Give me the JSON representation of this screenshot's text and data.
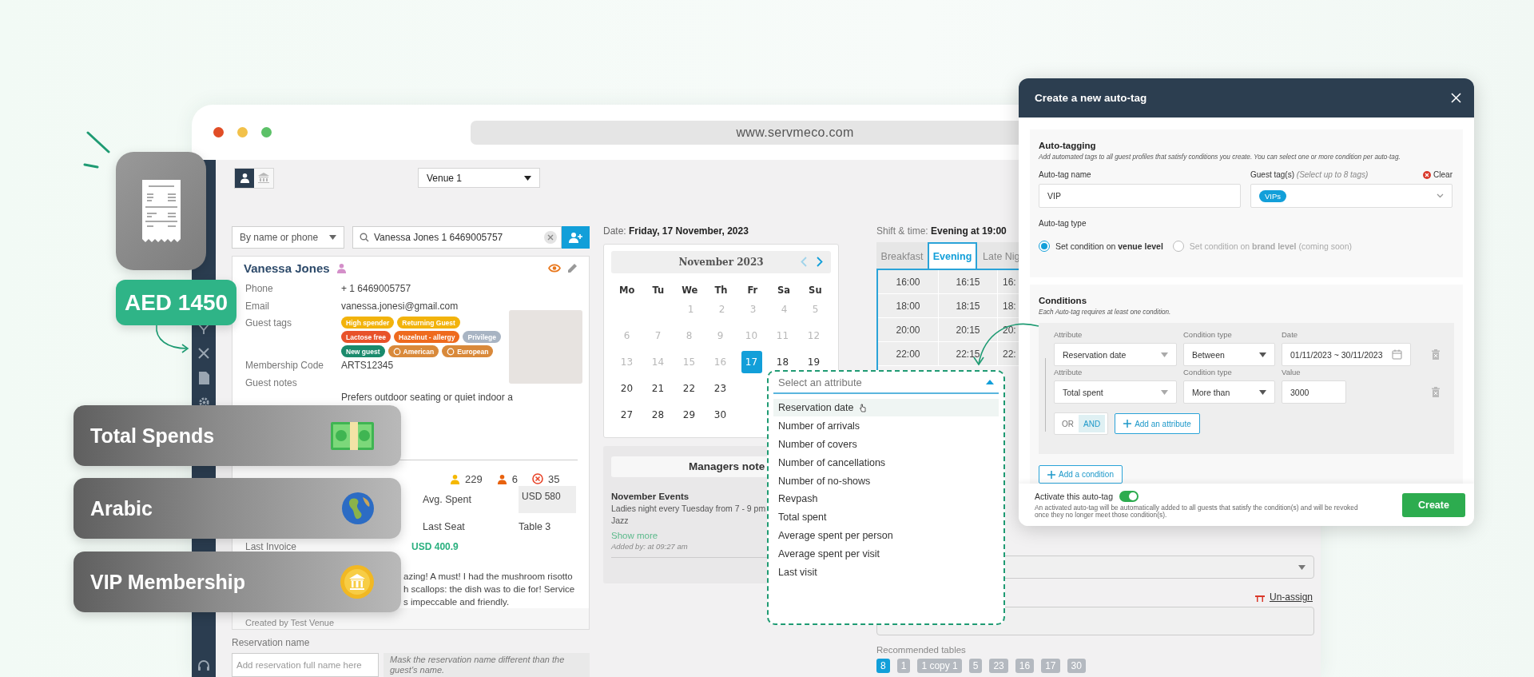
{
  "browser": {
    "url": "www.servmeco.com"
  },
  "top_bar": {
    "view_toggle": [
      {
        "kind": "guest",
        "selected": true
      },
      {
        "kind": "venue",
        "selected": false
      }
    ],
    "venue": "Venue 1"
  },
  "guest_search": {
    "mode": "By name or phone",
    "query": "Vanessa Jones 1 6469005757"
  },
  "guest": {
    "name": "Vanessa Jones",
    "fields": [
      {
        "label": "Phone",
        "value": "+ 1 6469005757"
      },
      {
        "label": "Email",
        "value": "vanessa.jonesi@gmail.com"
      }
    ],
    "tags_label": "Guest tags",
    "tags": [
      {
        "label": "High spender",
        "color": "#f2b30c",
        "kind": "plain"
      },
      {
        "label": "Returning Guest",
        "color": "#f2b30c",
        "kind": "plain"
      },
      {
        "label": "Lactose free",
        "color": "#e8522a",
        "kind": "plain"
      },
      {
        "label": "Hazelnut - allergy",
        "color": "#ee6a1e",
        "kind": "plain"
      },
      {
        "label": "Privilege",
        "color": "#a8b4c3",
        "kind": "plain"
      },
      {
        "label": "New guest",
        "color": "#1a8a6c",
        "kind": "plain"
      },
      {
        "label": "American",
        "color": "#d9893a",
        "kind": "origin"
      },
      {
        "label": "European",
        "color": "#d9893a",
        "kind": "origin"
      }
    ],
    "membership": {
      "label": "Membership Code",
      "value": "ARTS12345"
    },
    "notes": {
      "label": "Guest notes",
      "value": "Prefers outdoor seating or quiet indoor a"
    },
    "history": [
      {
        "kind": "person",
        "value": "229",
        "color": "#f5b800"
      },
      {
        "kind": "person",
        "value": "6",
        "color": "#e8620f"
      },
      {
        "kind": "cancel",
        "value": "35",
        "color": "#e8452a"
      }
    ],
    "stats": [
      {
        "label": "Avg. Spent",
        "value": "USD 580"
      },
      {
        "label": "Last Seat",
        "value": "Table 3"
      }
    ],
    "last_invoice": {
      "label": "Last Invoice",
      "value": "USD 400.9"
    },
    "review_lines": [
      "azing! A must! I had the mushroom risotto",
      "h scallops: the dish was to die for! Service",
      "s impeccable and friendly."
    ],
    "created_by": "Created by Test Venue"
  },
  "reservation_name": {
    "label": "Reservation name",
    "placeholder": "Add reservation full name here",
    "hint": "Mask the reservation name different than the guest's name."
  },
  "date": {
    "label": "Date:",
    "value": "Friday, 17 November, 2023"
  },
  "calendar": {
    "month": "November 2023",
    "weekdays": [
      "Mo",
      "Tu",
      "We",
      "Th",
      "Fr",
      "Sa",
      "Su"
    ],
    "weeks": [
      {
        "right_aligned": true,
        "days": [
          {
            "label": "1",
            "muted": true,
            "selected": false
          },
          {
            "label": "2",
            "muted": true,
            "selected": false
          },
          {
            "label": "3",
            "muted": true,
            "selected": false
          },
          {
            "label": "4",
            "muted": true,
            "selected": false
          },
          {
            "label": "5",
            "muted": true,
            "selected": false
          }
        ]
      },
      {
        "right_aligned": false,
        "days": [
          {
            "label": "6",
            "muted": true,
            "selected": false
          },
          {
            "label": "7",
            "muted": true,
            "selected": false
          },
          {
            "label": "8",
            "muted": true,
            "selected": false
          },
          {
            "label": "9",
            "muted": true,
            "selected": false
          },
          {
            "label": "10",
            "muted": true,
            "selected": false
          },
          {
            "label": "11",
            "muted": true,
            "selected": false
          },
          {
            "label": "12",
            "muted": true,
            "selected": false
          }
        ]
      },
      {
        "right_aligned": false,
        "days": [
          {
            "label": "13",
            "muted": true,
            "selected": false
          },
          {
            "label": "14",
            "muted": true,
            "selected": false
          },
          {
            "label": "15",
            "muted": true,
            "selected": false
          },
          {
            "label": "16",
            "muted": true,
            "selected": false
          },
          {
            "label": "17",
            "muted": false,
            "selected": true
          },
          {
            "label": "18",
            "muted": false,
            "selected": false
          },
          {
            "label": "19",
            "muted": false,
            "selected": false
          }
        ]
      },
      {
        "right_aligned": false,
        "days": [
          {
            "label": "20",
            "muted": false,
            "selected": false
          },
          {
            "label": "21",
            "muted": false,
            "selected": false
          },
          {
            "label": "22",
            "muted": false,
            "selected": false
          },
          {
            "label": "23",
            "muted": false,
            "selected": false
          }
        ]
      },
      {
        "right_aligned": false,
        "days": [
          {
            "label": "27",
            "muted": false,
            "selected": false
          },
          {
            "label": "28",
            "muted": false,
            "selected": false
          },
          {
            "label": "29",
            "muted": false,
            "selected": false
          },
          {
            "label": "30",
            "muted": false,
            "selected": false
          }
        ]
      }
    ]
  },
  "managers_notes": {
    "title": "Managers note",
    "heading": "November Events",
    "lines": [
      "Ladies night every Tuesday from 7 - 9 pm",
      "Jazz"
    ],
    "link": "Show more",
    "added_by": "Added by: at 09:27 am"
  },
  "shift": {
    "label": "Shift & time:",
    "value": "Evening at 19:00"
  },
  "shift_tabs": [
    {
      "label": "Breakfast",
      "selected": false
    },
    {
      "label": "Evening",
      "selected": true
    },
    {
      "label": "Late Nig",
      "selected": false
    }
  ],
  "time_slots": [
    [
      "16:00",
      "16:15",
      "16:"
    ],
    [
      "18:00",
      "18:15",
      "18:"
    ],
    [
      "20:00",
      "20:15",
      "20:"
    ],
    [
      "22:00",
      "22:15",
      "22:"
    ]
  ],
  "unassign": "Un-assign",
  "recommended_tables": {
    "label": "Recommended tables",
    "tables": [
      {
        "label": "8",
        "selected": true
      },
      {
        "label": "1",
        "selected": false
      },
      {
        "label": "1 copy 1",
        "selected": false
      },
      {
        "label": "5",
        "selected": false
      },
      {
        "label": "23",
        "selected": false
      },
      {
        "label": "16",
        "selected": false
      },
      {
        "label": "17",
        "selected": false
      },
      {
        "label": "30",
        "selected": false
      }
    ]
  },
  "attribute_dropdown": {
    "placeholder": "Select an attribute",
    "options": [
      {
        "label": "Reservation date",
        "highlighted": true
      },
      {
        "label": "Number of arrivals",
        "highlighted": false
      },
      {
        "label": "Number of covers",
        "highlighted": false
      },
      {
        "label": "Number of cancellations",
        "highlighted": false
      },
      {
        "label": "Number of no-shows",
        "highlighted": false
      },
      {
        "label": "Revpash",
        "highlighted": false
      },
      {
        "label": "Total spent",
        "highlighted": false
      },
      {
        "label": "Average spent per person",
        "highlighted": false
      },
      {
        "label": "Average spent per visit",
        "highlighted": false
      },
      {
        "label": "Last visit",
        "highlighted": false
      }
    ]
  },
  "modal": {
    "title": "Create a new auto-tag",
    "auto_tagging": {
      "heading": "Auto-tagging",
      "description": "Add automated tags to all guest profiles that satisfy conditions you create. You can select one or more condition per auto-tag.",
      "name_label": "Auto-tag name",
      "name_value": "VIP",
      "tags_label": "Guest tag(s) *(Select up to 8 tags)*",
      "clear": "Clear",
      "tags": [
        "VIPs"
      ],
      "type_label": "Auto-tag type",
      "type_options": [
        {
          "label": "Set condition on **venue level**",
          "selected": true,
          "disabled": false
        },
        {
          "label": "Set condition on **brand level** (coming soon)",
          "selected": false,
          "disabled": true
        }
      ]
    },
    "conditions": {
      "heading": "Conditions",
      "description": "Each Auto-tag requires at least one condition.",
      "rows": [
        {
          "kind": "date",
          "attribute_label": "Attribute",
          "attribute": "Reservation date",
          "type_label": "Condition type",
          "type": "Between",
          "value_label": "Date",
          "value": "01/11/2023 ~ 30/11/2023"
        },
        {
          "kind": "number",
          "attribute_label": "Attribute",
          "attribute": "Total spent",
          "type_label": "Condition type",
          "type": "More than",
          "value_label": "Value",
          "value": "3000"
        }
      ],
      "logic": [
        {
          "label": "OR",
          "selected": false
        },
        {
          "label": "AND",
          "selected": true
        }
      ],
      "add_attribute": "Add an attribute",
      "add_condition": "Add a condition"
    },
    "footer": {
      "activate_label": "Activate this auto-tag",
      "active": true,
      "note": "An activated auto-tag will be automatically added to all guests that satisfy the condition(s) and will be revoked once they no longer meet those condition(s).",
      "create": "Create"
    }
  },
  "highlights": {
    "amount": "AED 1450",
    "cards": [
      {
        "label": "Total Spends",
        "kind": "money"
      },
      {
        "label": "Arabic",
        "kind": "globe"
      },
      {
        "label": "VIP Membership",
        "kind": "coin"
      }
    ]
  }
}
